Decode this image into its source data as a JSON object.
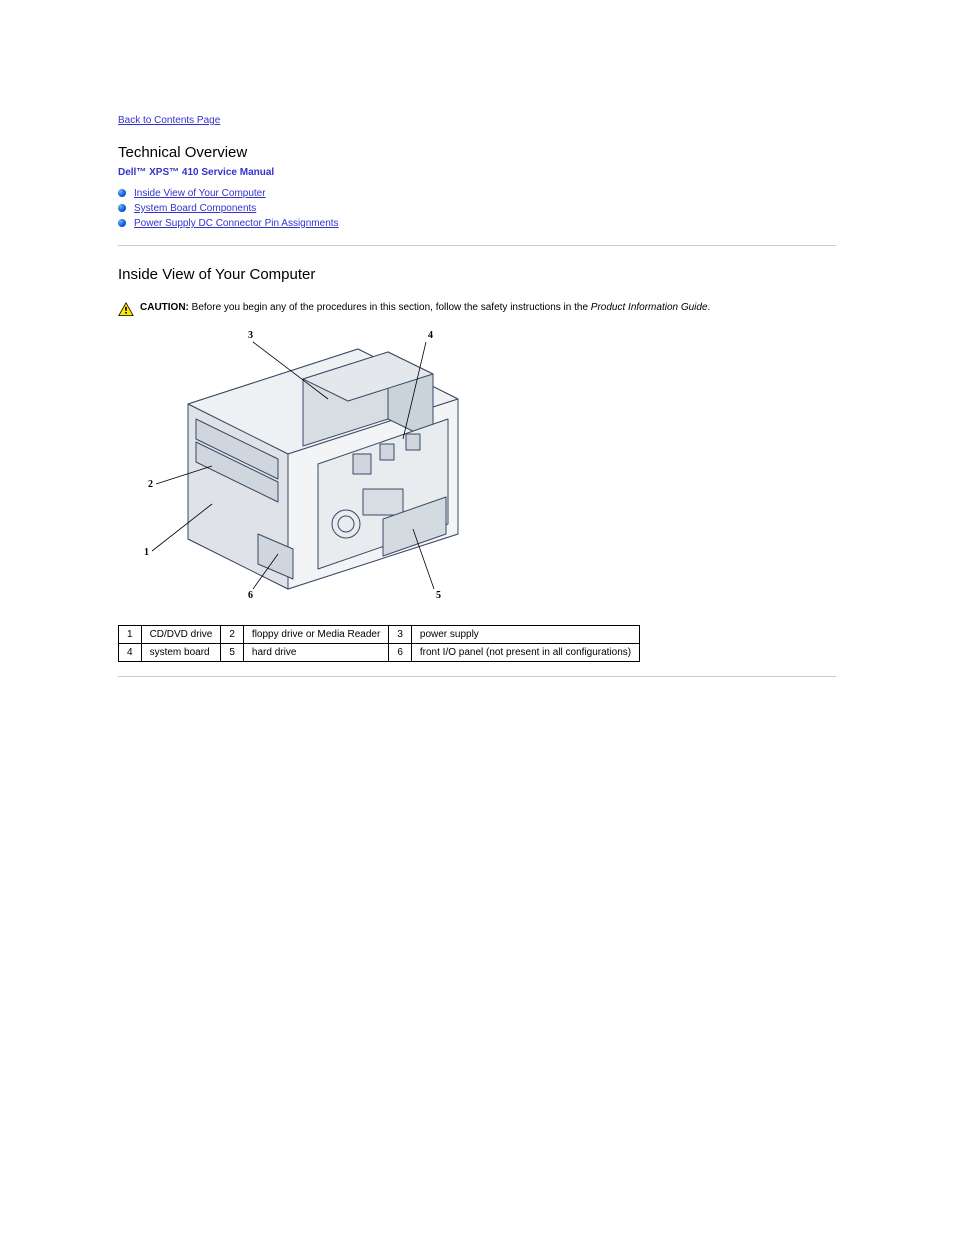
{
  "nav": {
    "back": "Back to Contents Page"
  },
  "header": {
    "title": "Technical Overview",
    "subtitle": "Dell™ XPS™ 410 Service Manual"
  },
  "toc": {
    "items": [
      {
        "label": "Inside View of Your Computer"
      },
      {
        "label": "System Board Components"
      },
      {
        "label": "Power Supply DC Connector Pin Assignments"
      }
    ]
  },
  "section": {
    "heading": "Inside View of Your Computer"
  },
  "caution": {
    "prefix": "CAUTION: ",
    "body_before": "Before you begin any of the procedures in this section, follow the safety instructions in the ",
    "guide": "Product Information Guide",
    "body_after": "."
  },
  "callouts": {
    "r1c1n": "1",
    "r1c1t": "CD/DVD drive",
    "r1c2n": "2",
    "r1c2t": "floppy drive or Media Reader",
    "r1c3n": "3",
    "r1c3t": "power supply",
    "r2c1n": "4",
    "r2c1t": "system board",
    "r2c2n": "5",
    "r2c2t": "hard drive",
    "r2c3n": "6",
    "r2c3t": "front I/O panel (not present in all configurations)"
  },
  "fig_labels": {
    "l1": "1",
    "l2": "2",
    "l3": "3",
    "l4": "4",
    "l5": "5",
    "l6": "6"
  }
}
